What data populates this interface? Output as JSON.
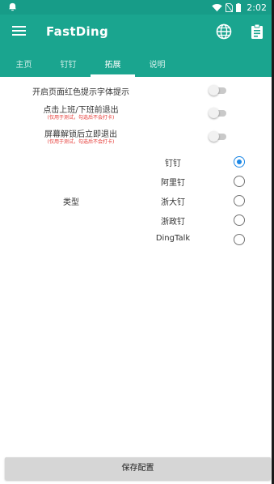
{
  "status_bar": {
    "time": "2:02"
  },
  "app_bar": {
    "title": "FastDing"
  },
  "tabs": [
    {
      "label": "主页"
    },
    {
      "label": "钉钉"
    },
    {
      "label": "拓展"
    },
    {
      "label": "说明"
    }
  ],
  "active_tab": "拓展",
  "settings": {
    "red_font_tip": {
      "label": "开启页面红色提示字体提示",
      "enabled": false
    },
    "exit_before_clock": {
      "label": "点击上班/下班前退出",
      "note": "(仅用于测试，勾选后不会打卡)",
      "enabled": false
    },
    "exit_on_unlock": {
      "label": "屏幕解锁后立即退出",
      "note": "(仅用于测试，勾选后不会打卡)",
      "enabled": false
    }
  },
  "type_selector": {
    "label": "类型",
    "options": [
      "钉钉",
      "阿里钉",
      "浙大钉",
      "浙政钉",
      "DingTalk"
    ],
    "selected": "钉钉"
  },
  "save_button": {
    "label": "保存配置"
  },
  "colors": {
    "primary": "#1aa58f",
    "status_bar": "#179c88",
    "accent": "#1e88e5",
    "warning_text": "#e53935"
  },
  "icons": [
    "notification-icon",
    "wifi-icon",
    "no-sim-icon",
    "battery-icon",
    "menu-icon",
    "globe-icon",
    "clipboard-icon"
  ]
}
